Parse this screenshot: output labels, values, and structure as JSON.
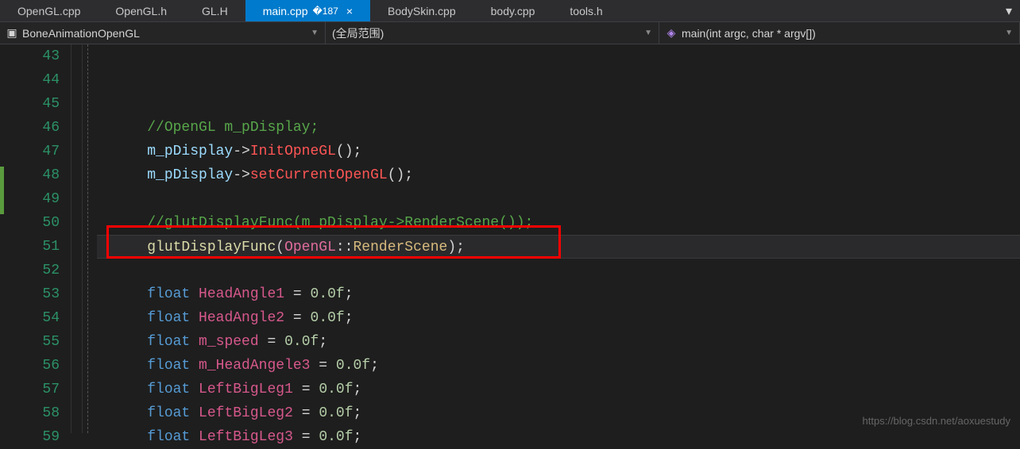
{
  "tabs": [
    {
      "label": "OpenGL.cpp",
      "active": false
    },
    {
      "label": "OpenGL.h",
      "active": false
    },
    {
      "label": "GL.H",
      "active": false
    },
    {
      "label": "main.cpp",
      "active": true
    },
    {
      "label": "BodySkin.cpp",
      "active": false
    },
    {
      "label": "body.cpp",
      "active": false
    },
    {
      "label": "tools.h",
      "active": false
    }
  ],
  "nav": {
    "scope1": "BoneAnimationOpenGL",
    "scope2": "(全局范围)",
    "scope3": "main(int argc, char * argv[])"
  },
  "lines": {
    "start": 43,
    "end": 59
  },
  "code": {
    "l46_comment": "//OpenGL m_pDisplay;",
    "l47_var": "m_pDisplay",
    "l47_method": "InitOpneGL",
    "l48_var": "m_pDisplay",
    "l48_method": "setCurrentOpenGL",
    "l50_comment": "//glutDisplayFunc(m_pDisplay->RenderScene());",
    "l51_func": "glutDisplayFunc",
    "l51_type": "OpenGL",
    "l51_ident": "RenderScene",
    "l53_kw": "float",
    "l53_field": "HeadAngle1",
    "l53_val": "0.0f",
    "l54_kw": "float",
    "l54_field": "HeadAngle2",
    "l54_val": "0.0f",
    "l55_kw": "float",
    "l55_field": "m_speed",
    "l55_val": "0.0f",
    "l56_kw": "float",
    "l56_field": "m_HeadAngele3",
    "l56_val": "0.0f",
    "l57_kw": "float",
    "l57_field": "LeftBigLeg1",
    "l57_val": "0.0f",
    "l58_kw": "float",
    "l58_field": "LeftBigLeg2",
    "l58_val": "0.0f",
    "l59_kw": "float",
    "l59_field": "LeftBigLeg3",
    "l59_val": "0.0f"
  },
  "watermark": "https://blog.csdn.net/aoxuestudy"
}
